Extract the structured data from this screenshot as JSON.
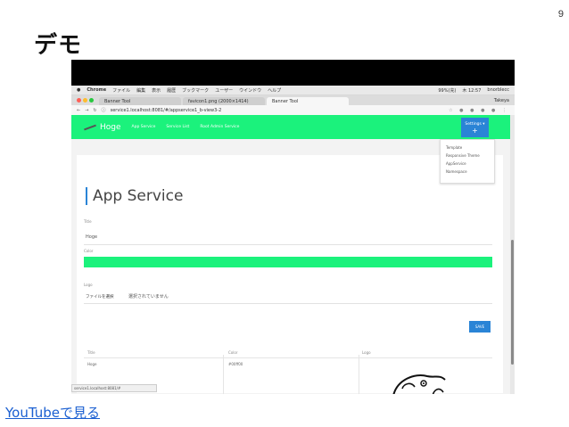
{
  "slide": {
    "page_number": "9",
    "title": "デモ",
    "link_text": "YouTubeで見る"
  },
  "mac_menubar": {
    "app": "Chrome",
    "menus": [
      "ファイル",
      "編集",
      "表示",
      "履歴",
      "ブックマーク",
      "ユーザー",
      "ウインドウ",
      "ヘルプ"
    ],
    "battery": "99%(充)",
    "clock": "木 12:57",
    "user": "bnorblecc"
  },
  "browser": {
    "tabs": [
      "Banner Tool",
      "favicon1.png (2000×1414)",
      "Banner Tool"
    ],
    "profile": "Takeya",
    "url": "service1.localhost:8081/#/appservice1_b-view3-2"
  },
  "app": {
    "brand": "Hoge",
    "nav_links": [
      "App Service",
      "Service List",
      "Root Admin Service"
    ],
    "settings_label": "Settings ▾",
    "settings_icon": "+",
    "dropdown": [
      "Template",
      "Responsive Theme",
      "AppService",
      "Namespace"
    ],
    "heading": "App Service",
    "title_label": "Title",
    "title_value": "Hoge",
    "color_label": "Color",
    "color_value": "#1bf27c",
    "logo_label": "Logo",
    "file_button": "ファイルを選択",
    "file_status": "選択されていません",
    "save_label": "SAVE",
    "table": {
      "headers": [
        "Title",
        "Color",
        "Logo"
      ],
      "row": [
        "Hoge",
        "#00ff00"
      ]
    },
    "status_url": "service1.localhost:8081/#"
  }
}
